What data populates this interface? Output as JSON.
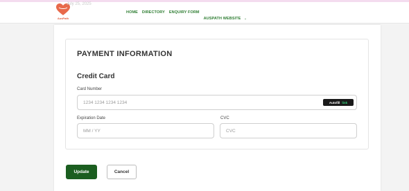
{
  "header": {
    "logo_text": "AusPath",
    "ghost_date": "July 25, 2025",
    "nav": [
      {
        "label": "HOME"
      },
      {
        "label": "DIRECTORY"
      },
      {
        "label": "ENQUIRY FORM"
      },
      {
        "label": "AUSPATH WEBSITE"
      }
    ]
  },
  "payment": {
    "title": "PAYMENT INFORMATION",
    "subtitle": "Credit Card",
    "card_number_label": "Card Number",
    "card_number_placeholder": "1234 1234 1234 1234",
    "autofill_label": "Autofill",
    "autofill_link": "link",
    "expiration_label": "Expiration Date",
    "expiration_placeholder": "MM / YY",
    "cvc_label": "CVC",
    "cvc_placeholder": "CVC"
  },
  "actions": {
    "update_label": "Update",
    "cancel_label": "Cancel"
  },
  "colors": {
    "accent_green": "#1b5e20",
    "nav_green": "#2e7d32",
    "logo_orange": "#e0593a"
  }
}
